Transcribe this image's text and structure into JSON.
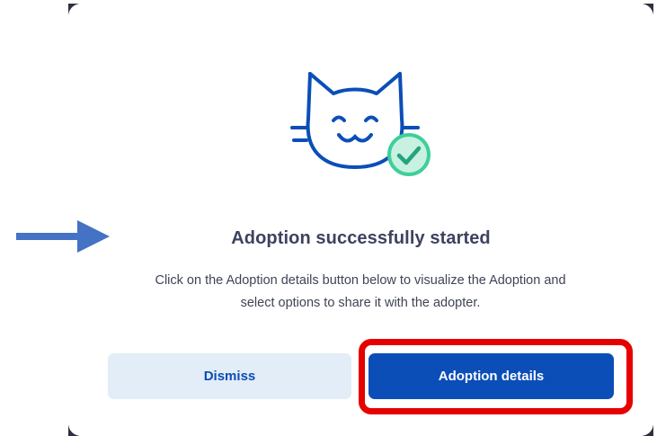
{
  "modal": {
    "illustration_icon": "cat-face-with-check-icon",
    "title": "Adoption successfully started",
    "message_line1": "Click on the Adoption details button below to visualize the Adoption and",
    "message_line2": "select options to share it with the adopter.",
    "dismiss_label": "Dismiss",
    "details_label": "Adoption details"
  },
  "annotations": {
    "arrow_icon": "right-arrow-icon",
    "arrow_color": "#4472c4",
    "highlight_color": "#e60000"
  },
  "colors": {
    "primary": "#0b4eb8",
    "secondary_bg": "#e2edf7",
    "check_green": "#3fcf9a",
    "title_text": "#3d4260"
  }
}
